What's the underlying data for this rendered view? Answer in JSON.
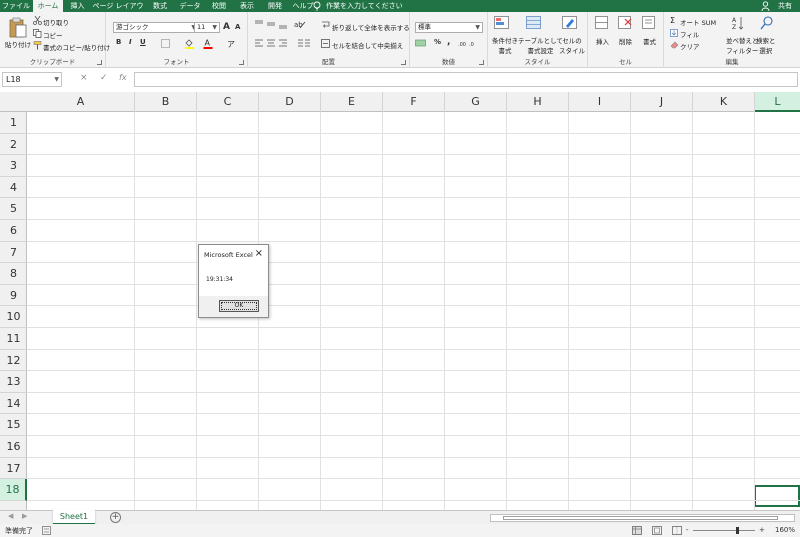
{
  "menu": {
    "tabs": [
      {
        "label": "ファイル",
        "active": false
      },
      {
        "label": "ホーム",
        "active": true
      },
      {
        "label": "挿入",
        "active": false
      },
      {
        "label": "ページ レイアウト",
        "active": false
      },
      {
        "label": "数式",
        "active": false
      },
      {
        "label": "データ",
        "active": false
      },
      {
        "label": "校閲",
        "active": false
      },
      {
        "label": "表示",
        "active": false
      },
      {
        "label": "開発",
        "active": false
      },
      {
        "label": "ヘルプ",
        "active": false
      }
    ],
    "tell_me": "作業を入力してください",
    "share": "共有"
  },
  "ribbon": {
    "clipboard": {
      "label": "クリップボード",
      "paste": "貼り付け",
      "cut": "切り取り",
      "copy": "コピー",
      "format_painter": "書式のコピー/貼り付け"
    },
    "font": {
      "label": "フォント",
      "font_name": "游ゴシック",
      "font_size": "11",
      "grow": "A",
      "shrink": "A",
      "bold": "B",
      "italic": "I",
      "underline": "U",
      "fill_color": "#ffff00",
      "font_color": "#ff0000"
    },
    "alignment": {
      "label": "配置",
      "wrap_text": "折り返して全体を表示する",
      "merge_center": "セルを結合して中央揃え"
    },
    "number": {
      "label": "数値",
      "format": "標準",
      "percent": "%",
      "comma": ","
    },
    "styles": {
      "label": "スタイル",
      "conditional": [
        "条件付き",
        "書式"
      ],
      "as_table": [
        "テーブルとして",
        "書式設定"
      ],
      "cell_styles": [
        "セルの",
        "スタイル"
      ]
    },
    "cells": {
      "label": "セル",
      "insert": "挿入",
      "delete": "削除",
      "format": "書式"
    },
    "editing": {
      "label": "編集",
      "autosum": "オート SUM",
      "fill": "フィル",
      "clear": "クリア",
      "sort_filter": [
        "並べ替えと",
        "フィルター"
      ],
      "find_select": [
        "検索と",
        "選択"
      ]
    }
  },
  "formula_bar": {
    "name_box": "L18",
    "cancel": "×",
    "enter": "✓",
    "function": "fx",
    "content": ""
  },
  "grid": {
    "columns": [
      "A",
      "B",
      "C",
      "D",
      "E",
      "F",
      "G",
      "H",
      "I",
      "J",
      "K",
      "L"
    ],
    "rows": [
      "1",
      "2",
      "3",
      "4",
      "5",
      "6",
      "7",
      "8",
      "9",
      "10",
      "11",
      "12",
      "13",
      "14",
      "15",
      "16",
      "17",
      "18"
    ],
    "selected_column": "L",
    "selected_row": "18"
  },
  "dialog": {
    "title": "Microsoft Excel",
    "message": "19:31:34",
    "ok": "OK",
    "close": "×"
  },
  "sheets": {
    "tabs": [
      "Sheet1"
    ],
    "add": "+"
  },
  "status": {
    "ready": "準備完了",
    "zoom": "160%",
    "zoom_minus": "-",
    "zoom_plus": "+"
  },
  "colors": {
    "accent": "#217346",
    "selection_fill": "#d3f0e0"
  }
}
